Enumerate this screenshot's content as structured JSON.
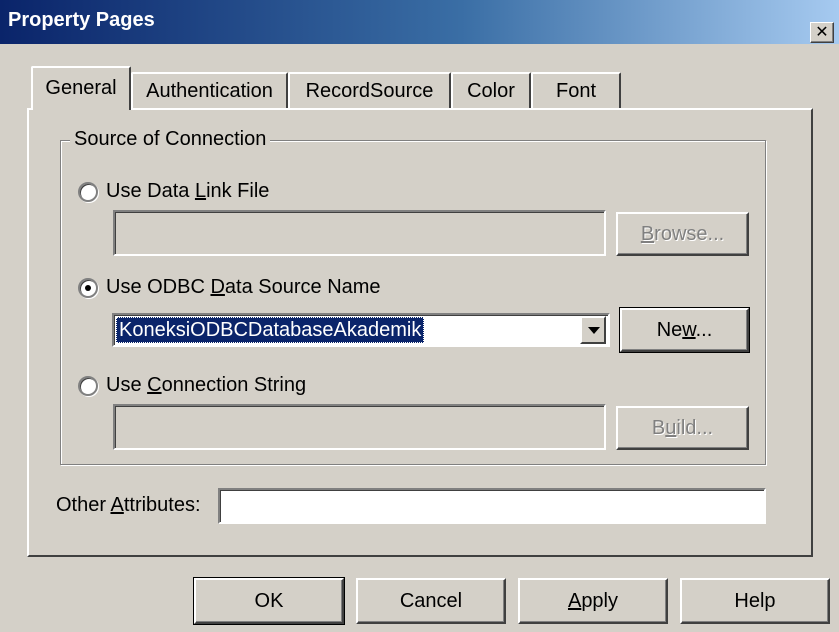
{
  "window": {
    "title": "Property Pages",
    "close_glyph": "✕"
  },
  "tabs": [
    {
      "label": "General",
      "active": true
    },
    {
      "label": "Authentication",
      "active": false
    },
    {
      "label": "RecordSource",
      "active": false
    },
    {
      "label": "Color",
      "active": false
    },
    {
      "label": "Font",
      "active": false
    }
  ],
  "source_group": {
    "legend": "Source of Connection",
    "data_link": {
      "label_pre": "Use Data ",
      "label_accel": "L",
      "label_post": "ink File",
      "selected": false,
      "value": "",
      "browse_pre": "",
      "browse_accel": "B",
      "browse_post": "rowse..."
    },
    "odbc": {
      "label_pre": "Use ODBC ",
      "label_accel": "D",
      "label_post": "ata Source Name",
      "selected": true,
      "value": "KoneksiODBCDatabaseAkademik",
      "new_pre": "Ne",
      "new_accel": "w",
      "new_post": "..."
    },
    "conn_string": {
      "label_pre": "Use ",
      "label_accel": "C",
      "label_post": "onnection String",
      "selected": false,
      "value": "",
      "build_pre": "B",
      "build_accel": "u",
      "build_post": "ild..."
    }
  },
  "other_attributes": {
    "label_pre": "Other ",
    "label_accel": "A",
    "label_post": "ttributes:",
    "value": ""
  },
  "footer": {
    "ok": "OK",
    "cancel": "Cancel",
    "apply_accel": "A",
    "apply_post": "pply",
    "help": "Help"
  },
  "colors": {
    "title_start": "#0a246a",
    "title_end": "#a6caf0",
    "face": "#d4d0c8",
    "selection": "#0a246a"
  }
}
